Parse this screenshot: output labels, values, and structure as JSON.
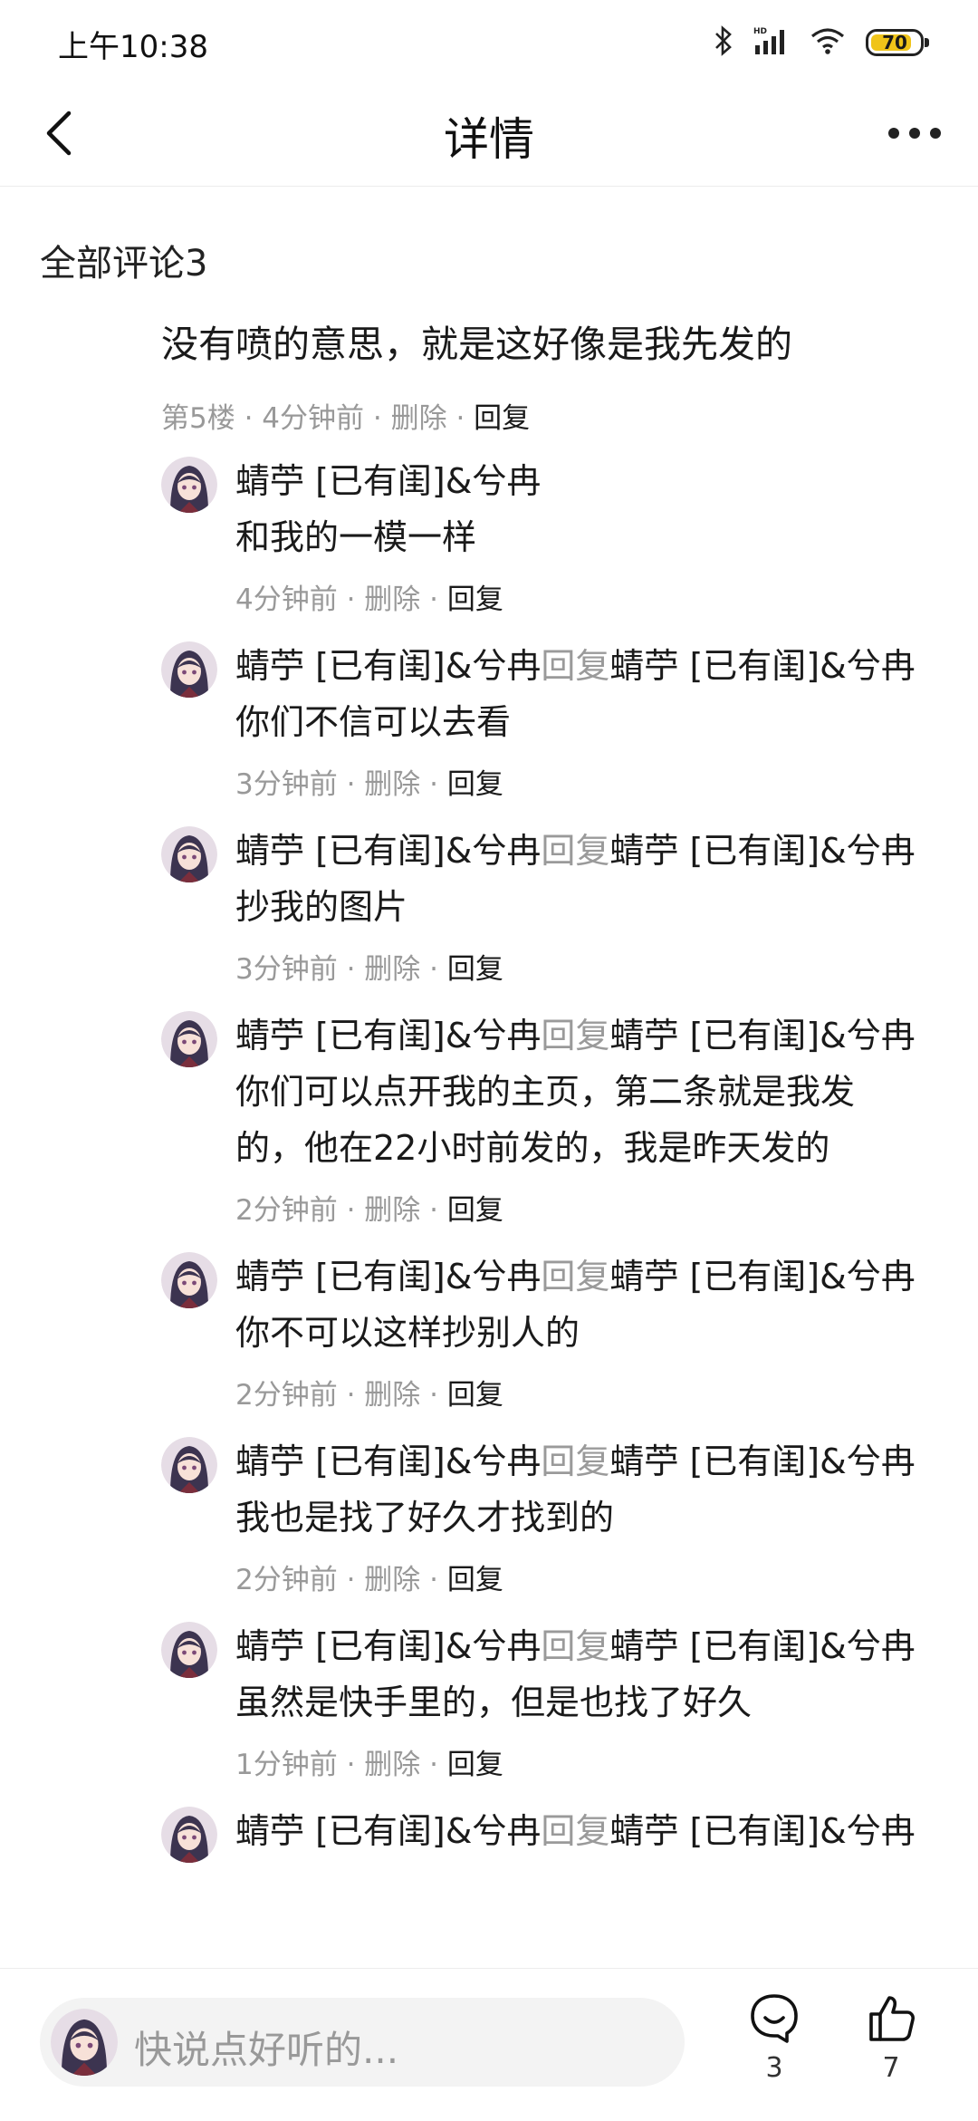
{
  "status": {
    "time": "上午10:38",
    "battery": "70",
    "battery_color": "#f0c419"
  },
  "header": {
    "title": "详情"
  },
  "comments_section": {
    "title": "全部评论3"
  },
  "main_comment": {
    "text": "没有喷的意思，就是这好像是我先发的",
    "floor": "第5楼",
    "time": "4分钟前",
    "delete_label": "删除",
    "reply_label": "回复"
  },
  "replies": [
    {
      "author": "蜻苧 [已有闺]&兮冉",
      "reply_kw": "",
      "target": "",
      "text": "和我的一模一样",
      "time": "4分钟前",
      "delete_label": "删除",
      "reply_label": "回复"
    },
    {
      "author": "蜻苧 [已有闺]&兮冉",
      "reply_kw": "回复",
      "target": "蜻苧 [已有闺]&兮冉",
      "text": "你们不信可以去看",
      "time": "3分钟前",
      "delete_label": "删除",
      "reply_label": "回复"
    },
    {
      "author": "蜻苧 [已有闺]&兮冉",
      "reply_kw": "回复",
      "target": "蜻苧 [已有闺]&兮冉",
      "text": "抄我的图片",
      "time": "3分钟前",
      "delete_label": "删除",
      "reply_label": "回复"
    },
    {
      "author": "蜻苧 [已有闺]&兮冉",
      "reply_kw": "回复",
      "target": "蜻苧 [已有闺]&兮冉",
      "text": "你们可以点开我的主页，第二条就是我发的，他在22小时前发的，我是昨天发的",
      "time": "2分钟前",
      "delete_label": "删除",
      "reply_label": "回复"
    },
    {
      "author": "蜻苧 [已有闺]&兮冉",
      "reply_kw": "回复",
      "target": "蜻苧 [已有闺]&兮冉",
      "text": "你不可以这样抄别人的",
      "time": "2分钟前",
      "delete_label": "删除",
      "reply_label": "回复"
    },
    {
      "author": "蜻苧 [已有闺]&兮冉",
      "reply_kw": "回复",
      "target": "蜻苧 [已有闺]&兮冉",
      "text": "我也是找了好久才找到的",
      "time": "2分钟前",
      "delete_label": "删除",
      "reply_label": "回复"
    },
    {
      "author": "蜻苧 [已有闺]&兮冉",
      "reply_kw": "回复",
      "target": "蜻苧 [已有闺]&兮冉",
      "text": "虽然是快手里的，但是也找了好久",
      "time": "1分钟前",
      "delete_label": "删除",
      "reply_label": "回复"
    },
    {
      "author": "蜻苧 [已有闺]&兮冉",
      "reply_kw": "回复",
      "target": "蜻苧 [已有闺]&兮冉",
      "text": "",
      "time": "",
      "delete_label": "",
      "reply_label": ""
    }
  ],
  "bottom_bar": {
    "placeholder": "快说点好听的...",
    "comment_count": "3",
    "like_count": "7"
  }
}
